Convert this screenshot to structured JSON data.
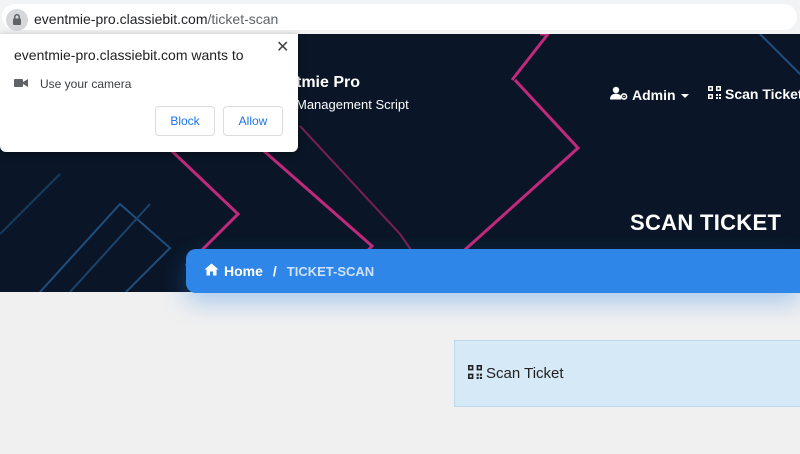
{
  "browser": {
    "url_host": "eventmie-pro.classiebit.com",
    "url_path": "/ticket-scan",
    "lock_icon": "lock-icon"
  },
  "header": {
    "brand_title": "tmie Pro",
    "brand_subtitle": "Management Script",
    "nav": {
      "admin_label": "Admin",
      "admin_icon": "user-cog-icon",
      "scan_label": "Scan Ticket",
      "scan_icon": "qrcode-icon"
    },
    "page_title": "SCAN TICKET"
  },
  "breadcrumb": {
    "home_label": "Home",
    "home_icon": "home-icon",
    "separator": "/",
    "current": "TICKET-SCAN"
  },
  "card": {
    "title": "Scan Ticket",
    "icon": "qrcode-icon"
  },
  "permission_popup": {
    "message": "eventmie-pro.classiebit.com wants to",
    "permission_label": "Use your camera",
    "permission_icon": "camera-icon",
    "close_symbol": "✕",
    "block_label": "Block",
    "allow_label": "Allow"
  },
  "colors": {
    "hero_bg": "#0a1627",
    "accent_blue": "#2e87e8",
    "deco_pink": "#c2297a",
    "deco_blue": "#1f6fb6"
  }
}
